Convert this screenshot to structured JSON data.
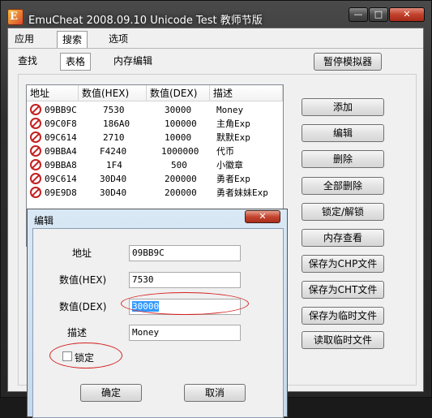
{
  "window": {
    "title": "EmuCheat  2008.09.10 Unicode Test 教师节版",
    "min": "—",
    "max": "□",
    "close": "✕",
    "icon_letter": "E"
  },
  "menu": [
    "应用",
    "搜索",
    "选项"
  ],
  "subtabs": [
    "查找",
    "表格",
    "内存编辑"
  ],
  "pause_button": "暂停模拟器",
  "list": {
    "headers": [
      "地址",
      "数值(HEX)",
      "数值(DEX)",
      "描述"
    ],
    "rows": [
      {
        "addr": "09BB9C",
        "hex": "7530",
        "dec": "30000",
        "desc": "Money"
      },
      {
        "addr": "09C0F8",
        "hex": "186A0",
        "dec": "100000",
        "desc": "主角Exp"
      },
      {
        "addr": "09C614",
        "hex": "2710",
        "dec": "10000",
        "desc": "默默Exp"
      },
      {
        "addr": "09BBA4",
        "hex": "F4240",
        "dec": "1000000",
        "desc": "代币"
      },
      {
        "addr": "09BBA8",
        "hex": "1F4",
        "dec": "500",
        "desc": "小徽章"
      },
      {
        "addr": "09C614",
        "hex": "30D40",
        "dec": "200000",
        "desc": "勇者Exp"
      },
      {
        "addr": "09E9D8",
        "hex": "30D40",
        "dec": "200000",
        "desc": "勇者妹妹Exp"
      }
    ]
  },
  "side_buttons": [
    "添加",
    "编辑",
    "删除",
    "全部删除",
    "锁定/解锁",
    "内存查看",
    "保存为CHP文件",
    "保存为CHT文件",
    "保存为临时文件",
    "读取临时文件"
  ],
  "dialog": {
    "title": "编辑",
    "close": "✕",
    "addr_label": "地址",
    "addr_value": "09BB9C",
    "hex_label": "数值(HEX)",
    "hex_value": "7530",
    "dec_label": "数值(DEX)",
    "dec_value": "30000",
    "desc_label": "描述",
    "desc_value": "Money",
    "lock_label": "锁定",
    "ok": "确定",
    "cancel": "取消"
  }
}
